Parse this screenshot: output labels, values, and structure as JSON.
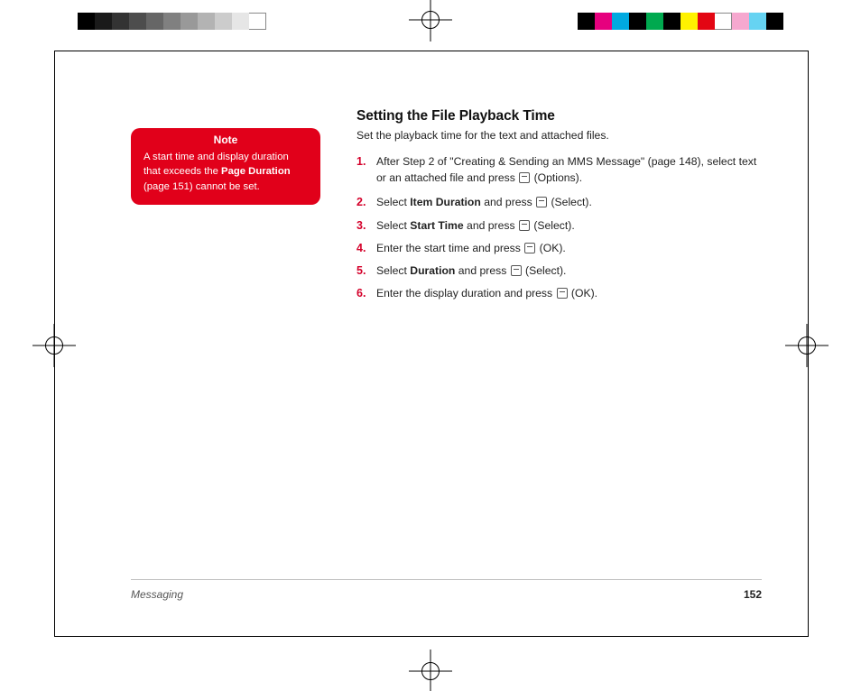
{
  "heading": "Setting the File Playback Time",
  "subtitle": "Set the playback time for the text and attached files.",
  "steps": {
    "s1": {
      "num": "1.",
      "pre": "After Step 2 of \"Creating & Sending an MMS Message\" (page 148), select text or an attached file and press ",
      "after": " (Options)."
    },
    "s2": {
      "num": "2.",
      "pre": "Select ",
      "bold": "Item Duration",
      "mid": " and press ",
      "after": " (Select)."
    },
    "s3": {
      "num": "3.",
      "pre": "Select ",
      "bold": "Start Time",
      "mid": " and press ",
      "after": " (Select)."
    },
    "s4": {
      "num": "4.",
      "pre": "Enter the start time and press ",
      "after": " (OK)."
    },
    "s5": {
      "num": "5.",
      "pre": "Select ",
      "bold": "Duration",
      "mid": " and press ",
      "after": " (Select)."
    },
    "s6": {
      "num": "6.",
      "pre": "Enter the display duration and press ",
      "after": " (OK)."
    }
  },
  "note": {
    "title": "Note",
    "line1": "A start time and display duration that exceeds the ",
    "bold": "Page Duration",
    "line2": " (page 151) cannot be set."
  },
  "footer": {
    "section": "Messaging",
    "page": "152"
  }
}
